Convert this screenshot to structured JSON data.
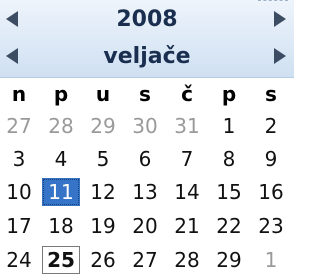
{
  "header": {
    "year": "2008",
    "month": "veljače"
  },
  "weekdays": [
    "n",
    "p",
    "u",
    "s",
    "č",
    "p",
    "s"
  ],
  "weeks": [
    [
      {
        "t": "27",
        "o": true
      },
      {
        "t": "28",
        "o": true
      },
      {
        "t": "29",
        "o": true
      },
      {
        "t": "30",
        "o": true
      },
      {
        "t": "31",
        "o": true
      },
      {
        "t": "1"
      },
      {
        "t": "2"
      }
    ],
    [
      {
        "t": "3"
      },
      {
        "t": "4"
      },
      {
        "t": "5"
      },
      {
        "t": "6"
      },
      {
        "t": "7"
      },
      {
        "t": "8"
      },
      {
        "t": "9"
      }
    ],
    [
      {
        "t": "10"
      },
      {
        "t": "11",
        "sel": true
      },
      {
        "t": "12"
      },
      {
        "t": "13"
      },
      {
        "t": "14"
      },
      {
        "t": "15"
      },
      {
        "t": "16"
      }
    ],
    [
      {
        "t": "17"
      },
      {
        "t": "18"
      },
      {
        "t": "19"
      },
      {
        "t": "20"
      },
      {
        "t": "21"
      },
      {
        "t": "22"
      },
      {
        "t": "23"
      }
    ],
    [
      {
        "t": "24"
      },
      {
        "t": "25",
        "today": true
      },
      {
        "t": "26"
      },
      {
        "t": "27"
      },
      {
        "t": "28"
      },
      {
        "t": "29"
      },
      {
        "t": "1",
        "o": true
      }
    ]
  ]
}
